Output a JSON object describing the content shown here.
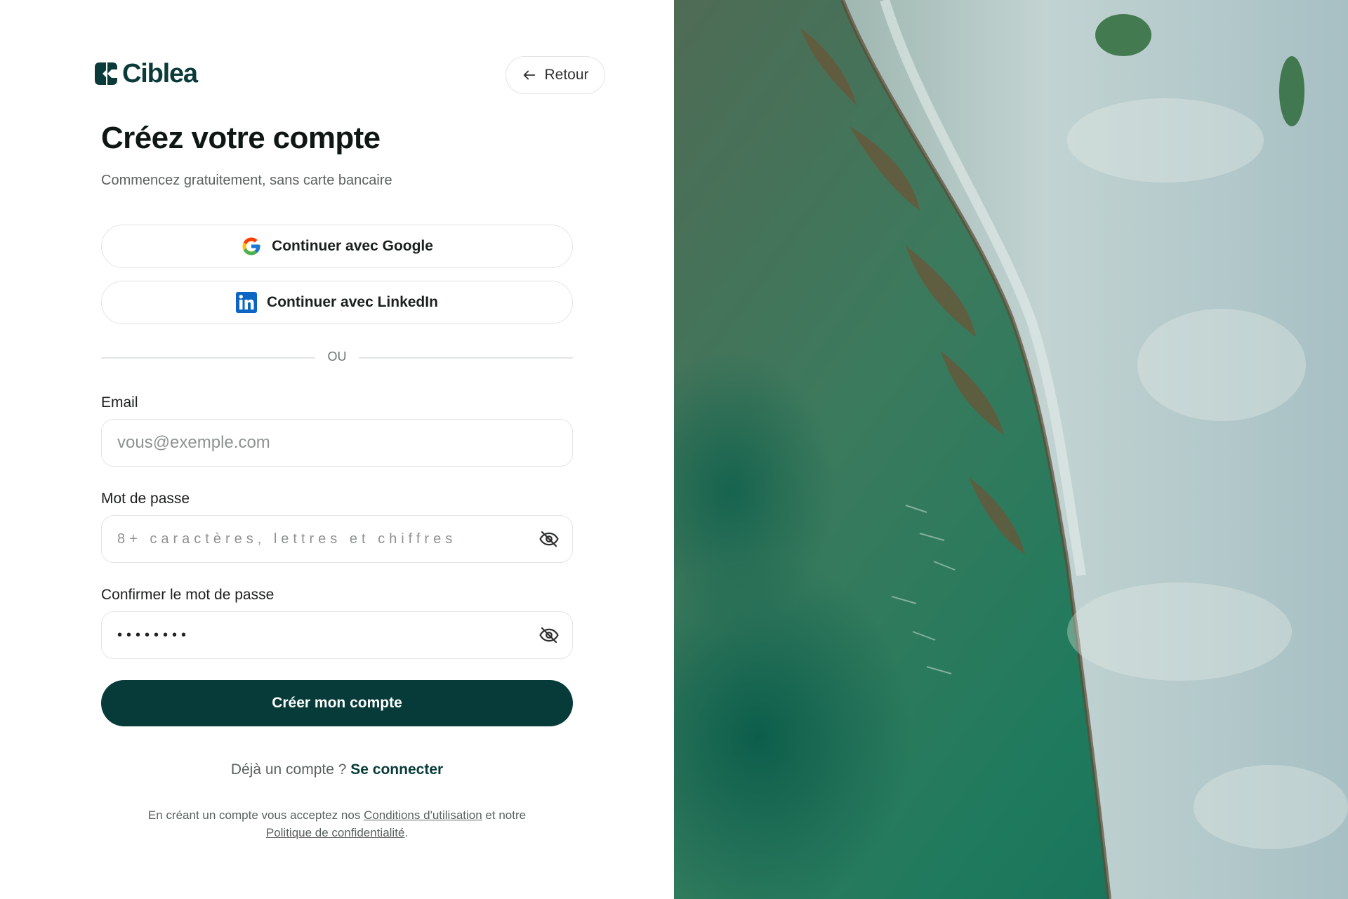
{
  "brand": {
    "name": "Ciblea",
    "color": "#0b3b39"
  },
  "header": {
    "back_label": "Retour",
    "back_icon": "arrow-left-icon"
  },
  "hero": {
    "title": "Créez votre compte",
    "subtitle": "Commencez gratuitement, sans carte bancaire"
  },
  "oauth": {
    "google_label": "Continuer avec Google",
    "linkedin_label": "Continuer avec LinkedIn"
  },
  "divider": {
    "label": "OU"
  },
  "form": {
    "email": {
      "label": "Email",
      "placeholder": "vous@exemple.com",
      "value": ""
    },
    "password": {
      "label": "Mot de passe",
      "placeholder": "8+ caractères, lettres et chiffres",
      "value": ""
    },
    "confirm": {
      "label": "Confirmer le mot de passe",
      "value": "••••••••"
    },
    "toggle_icon": "eye-off-icon",
    "submit_label": "Créer mon compte"
  },
  "signin": {
    "prompt": "Déjà un compte ?",
    "link": "Se connecter"
  },
  "legal": {
    "before": "En créant un compte vous acceptez nos",
    "terms": "Conditions d'utilisation",
    "middle": "et notre",
    "privacy": "Politique de confidentialité",
    "after": "."
  },
  "colors": {
    "primary": "#073b39",
    "border": "#e2e5e4",
    "muted_text": "#5b615f",
    "google_blue": "#4285F4",
    "google_red": "#EA4335",
    "google_yellow": "#FBBC05",
    "google_green": "#34A853",
    "linkedin_blue": "#0A66C2"
  },
  "image": {
    "subject": "aerial-coastline-photo"
  }
}
